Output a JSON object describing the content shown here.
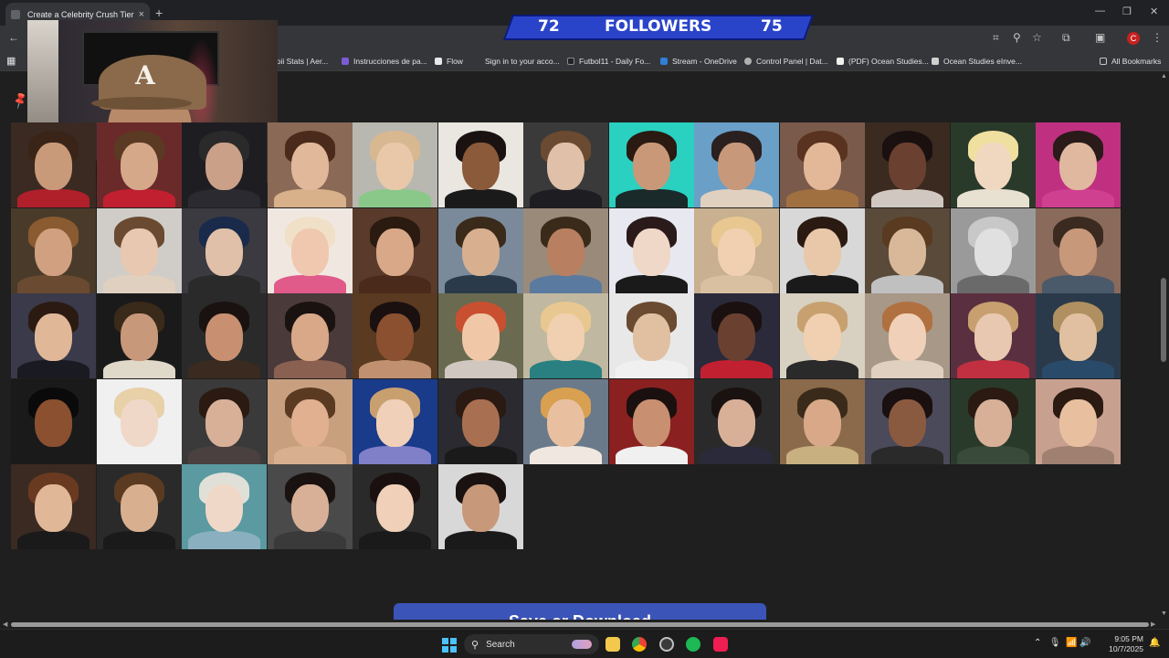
{
  "browser": {
    "tab_title": "Create a Celebrity Crush Tier Li",
    "new_tab_label": "+",
    "tab_close": "×",
    "window_controls": {
      "minimize": "—",
      "restore": "❐",
      "close": "✕"
    },
    "toolbar_icons": [
      "back-icon",
      "translate-icon",
      "zoom-icon",
      "star-icon",
      "extensions-icon",
      "sidebar-icon",
      "profile-icon",
      "menu-icon"
    ],
    "profile_initial": "C"
  },
  "bookmarks": [
    {
      "label": "npii Stats | Aer...",
      "color": "#4a4a4a"
    },
    {
      "label": "Instrucciones de pa...",
      "color": "#7b5cd6"
    },
    {
      "label": "Flow",
      "color": "#e8e8e8"
    },
    {
      "label": "Sign in to your acco...",
      "color": "#4a4a4a"
    },
    {
      "label": "Futbol11 - Daily Fo...",
      "color": "#222222"
    },
    {
      "label": "Stream - OneDrive",
      "color": "#2f7fd6"
    },
    {
      "label": "Control Panel | Dat...",
      "color": "#b0b0b0"
    },
    {
      "label": "(PDF) Ocean Studies...",
      "color": "#f0f0f0"
    },
    {
      "label": "Ocean Studies eInve...",
      "color": "#d0d0d0"
    }
  ],
  "all_bookmarks_label": "All Bookmarks",
  "followers": {
    "current": "72",
    "label": "FOLLOWERS",
    "goal": "75"
  },
  "grid": {
    "columns": 13,
    "tiles": [
      {
        "name": "tile-1-1",
        "bg": "#3a2a22",
        "face": "#c99a7a",
        "hair": "#3a2418",
        "body": "#b0202a"
      },
      {
        "name": "tile-1-2",
        "bg": "#6a2a2a",
        "face": "#d6a88a",
        "hair": "#5a3a22",
        "body": "#c02030"
      },
      {
        "name": "tile-1-3",
        "bg": "#1e1e22",
        "face": "#caa088",
        "hair": "#2a2a2a",
        "body": "#2a2a30"
      },
      {
        "name": "tile-1-4",
        "bg": "#8a6a56",
        "face": "#e2b89a",
        "hair": "#4a2a1a",
        "body": "#d8b08a"
      },
      {
        "name": "tile-1-5",
        "bg": "#b8b8b0",
        "face": "#e8c8a8",
        "hair": "#d8b890",
        "body": "#8ac88a"
      },
      {
        "name": "tile-1-6",
        "bg": "#eae6e0",
        "face": "#8a5a3a",
        "hair": "#1a1210",
        "body": "#1a1a1a"
      },
      {
        "name": "tile-1-7",
        "bg": "#3a3a3a",
        "face": "#e0c0a8",
        "hair": "#6a4a30",
        "body": "#1e1e22"
      },
      {
        "name": "tile-1-8",
        "bg": "#2ad0c0",
        "face": "#c89878",
        "hair": "#2a1a12",
        "body": "#1a2a2a"
      },
      {
        "name": "tile-1-9",
        "bg": "#6aa0c8",
        "face": "#c8987a",
        "hair": "#2a2020",
        "body": "#e0d0c0"
      },
      {
        "name": "tile-1-10",
        "bg": "#7a5a4a",
        "face": "#e2b898",
        "hair": "#5a3220",
        "body": "#a07040"
      },
      {
        "name": "tile-1-11",
        "bg": "#3a2a20",
        "face": "#6a4030",
        "hair": "#1a1010",
        "body": "#d0c8c0"
      },
      {
        "name": "tile-1-12",
        "bg": "#2a3a2a",
        "face": "#f0d8c0",
        "hair": "#f0e0a0",
        "body": "#e8e0d0"
      },
      {
        "name": "tile-1-13",
        "bg": "#c03080",
        "face": "#e0b8a0",
        "hair": "#2a1a1a",
        "body": "#d04090"
      },
      {
        "name": "tile-2-1",
        "bg": "#4a3a2a",
        "face": "#d0a080",
        "hair": "#8a5a30",
        "body": "#6a4a30"
      },
      {
        "name": "tile-2-2",
        "bg": "#d0ccc8",
        "face": "#e8c8b0",
        "hair": "#6a4a30",
        "body": "#e0d0c0"
      },
      {
        "name": "tile-2-3",
        "bg": "#3a3a40",
        "face": "#e0c0a8",
        "hair": "#1a2a4a",
        "body": "#2a2a2a"
      },
      {
        "name": "tile-2-4",
        "bg": "#f0e8e0",
        "face": "#f0c8b0",
        "hair": "#f0e0c8",
        "body": "#e05a8a"
      },
      {
        "name": "tile-2-5",
        "bg": "#5a3a2a",
        "face": "#d8a888",
        "hair": "#2a1a10",
        "body": "#4a2a1a"
      },
      {
        "name": "tile-2-6",
        "bg": "#7a8a9a",
        "face": "#d8b090",
        "hair": "#3a2a1a",
        "body": "#2a3a4a"
      },
      {
        "name": "tile-2-7",
        "bg": "#9a8a7a",
        "face": "#b88060",
        "hair": "#3a2a1a",
        "body": "#5a7aa0"
      },
      {
        "name": "tile-2-8",
        "bg": "#e8e8f0",
        "face": "#f0d8c8",
        "hair": "#2a1a1a",
        "body": "#1a1a1a"
      },
      {
        "name": "tile-2-9",
        "bg": "#c8b090",
        "face": "#f0d0b0",
        "hair": "#e8c890",
        "body": "#d8c0a0"
      },
      {
        "name": "tile-2-10",
        "bg": "#d8d8d8",
        "face": "#e8c8a8",
        "hair": "#2a1a12",
        "body": "#1a1a1a"
      },
      {
        "name": "tile-2-11",
        "bg": "#5a4a3a",
        "face": "#d8b898",
        "hair": "#5a3a20",
        "body": "#c0c0c0"
      },
      {
        "name": "tile-2-12",
        "bg": "#9a9a9a",
        "face": "#e0e0e0",
        "hair": "#c8c8c8",
        "body": "#6a6a6a"
      },
      {
        "name": "tile-2-13",
        "bg": "#8a6a5a",
        "face": "#c8987a",
        "hair": "#3a2a20",
        "body": "#4a5a6a"
      },
      {
        "name": "tile-3-1",
        "bg": "#3a3a4a",
        "face": "#e0b898",
        "hair": "#2a1a12",
        "body": "#1a1a22"
      },
      {
        "name": "tile-3-2",
        "bg": "#1a1a1a",
        "face": "#c8987a",
        "hair": "#3a2a1a",
        "body": "#e0d8c8"
      },
      {
        "name": "tile-3-3",
        "bg": "#2a2a2a",
        "face": "#c89070",
        "hair": "#1a1210",
        "body": "#3a2a20"
      },
      {
        "name": "tile-3-4",
        "bg": "#4a3a3a",
        "face": "#d8a888",
        "hair": "#1a1210",
        "body": "#8a6050"
      },
      {
        "name": "tile-3-5",
        "bg": "#5a3a20",
        "face": "#8a5030",
        "hair": "#1a1010",
        "body": "#c09070"
      },
      {
        "name": "tile-3-6",
        "bg": "#6a6a50",
        "face": "#f0c8a8",
        "hair": "#c85030",
        "body": "#d0c8c0"
      },
      {
        "name": "tile-3-7",
        "bg": "#c0b8a0",
        "face": "#f0d0b0",
        "hair": "#e8c890",
        "body": "#2a8080"
      },
      {
        "name": "tile-3-8",
        "bg": "#e8e8e8",
        "face": "#e0c0a0",
        "hair": "#6a4a30",
        "body": "#f0f0f0"
      },
      {
        "name": "tile-3-9",
        "bg": "#2a2a3a",
        "face": "#6a4030",
        "hair": "#1a1010",
        "body": "#c02030"
      },
      {
        "name": "tile-3-10",
        "bg": "#d8d0c0",
        "face": "#f0d0b0",
        "hair": "#c8a070",
        "body": "#2a2a2a"
      },
      {
        "name": "tile-3-11",
        "bg": "#a89888",
        "face": "#f0d0b8",
        "hair": "#b07040",
        "body": "#e0d0c0"
      },
      {
        "name": "tile-3-12",
        "bg": "#5a3040",
        "face": "#e8c8b0",
        "hair": "#c8a070",
        "body": "#c03040"
      },
      {
        "name": "tile-3-13",
        "bg": "#2a3a4a",
        "face": "#e0c0a0",
        "hair": "#b09060",
        "body": "#2a4a6a"
      },
      {
        "name": "tile-4-1",
        "bg": "#1a1a1a",
        "face": "#8a5030",
        "hair": "#0a0a0a",
        "body": "#1a1a1a"
      },
      {
        "name": "tile-4-2",
        "bg": "#f0f0f0",
        "face": "#f0d8c8",
        "hair": "#e8d0a8",
        "body": "#f0f0f0"
      },
      {
        "name": "tile-4-3",
        "bg": "#3a3a3a",
        "face": "#d8b098",
        "hair": "#2a1a12",
        "body": "#4a4040"
      },
      {
        "name": "tile-4-4",
        "bg": "#c8a080",
        "face": "#e0b090",
        "hair": "#5a3a20",
        "body": "#d8b090"
      },
      {
        "name": "tile-4-5",
        "bg": "#1a3a8a",
        "face": "#f0d0b8",
        "hair": "#c8a070",
        "body": "#8080c8"
      },
      {
        "name": "tile-4-6",
        "bg": "#2a2a30",
        "face": "#a87050",
        "hair": "#2a1a12",
        "body": "#1a1a1a"
      },
      {
        "name": "tile-4-7",
        "bg": "#6a7a8a",
        "face": "#e8c0a0",
        "hair": "#d8a050",
        "body": "#f0e8e0"
      },
      {
        "name": "tile-4-8",
        "bg": "#8a2020",
        "face": "#c89070",
        "hair": "#1a1010",
        "body": "#f0f0f0"
      },
      {
        "name": "tile-4-9",
        "bg": "#2a2a2a",
        "face": "#d8b098",
        "hair": "#1a1210",
        "body": "#2a2a3a"
      },
      {
        "name": "tile-4-10",
        "bg": "#8a6a4a",
        "face": "#d8a888",
        "hair": "#3a2a1a",
        "body": "#c8b080"
      },
      {
        "name": "tile-4-11",
        "bg": "#4a4a5a",
        "face": "#8a5a40",
        "hair": "#1a1010",
        "body": "#2a2a2a"
      },
      {
        "name": "tile-4-12",
        "bg": "#2a3a2a",
        "face": "#d8b098",
        "hair": "#2a1a12",
        "body": "#3a4a3a"
      },
      {
        "name": "tile-4-13",
        "bg": "#c8a090",
        "face": "#e8c0a0",
        "hair": "#2a1a12",
        "body": "#a08070"
      },
      {
        "name": "tile-5-1",
        "bg": "#3a2a22",
        "face": "#e0b898",
        "hair": "#6a3a20",
        "body": "#1a1a1a"
      },
      {
        "name": "tile-5-2",
        "bg": "#2a2a2a",
        "face": "#d8b090",
        "hair": "#5a3a20",
        "body": "#1a1a1a"
      },
      {
        "name": "tile-5-3",
        "bg": "#5a9aa0",
        "face": "#f0d8c8",
        "hair": "#e0e0d8",
        "body": "#8ab0c0"
      },
      {
        "name": "tile-5-4",
        "bg": "#4a4a4a",
        "face": "#d8b098",
        "hair": "#1a1210",
        "body": "#3a3a3a"
      },
      {
        "name": "tile-5-5",
        "bg": "#2a2a2a",
        "face": "#f0d0b8",
        "hair": "#1a1010",
        "body": "#1a1a1a"
      },
      {
        "name": "tile-5-6",
        "bg": "#d8d8d8",
        "face": "#c8987a",
        "hair": "#1a1210",
        "body": "#1a1a1a"
      }
    ]
  },
  "save_button_label": "Save or Download",
  "taskbar": {
    "search_placeholder": "Search",
    "time": "9:05 PM",
    "date": "10/7/2025"
  }
}
